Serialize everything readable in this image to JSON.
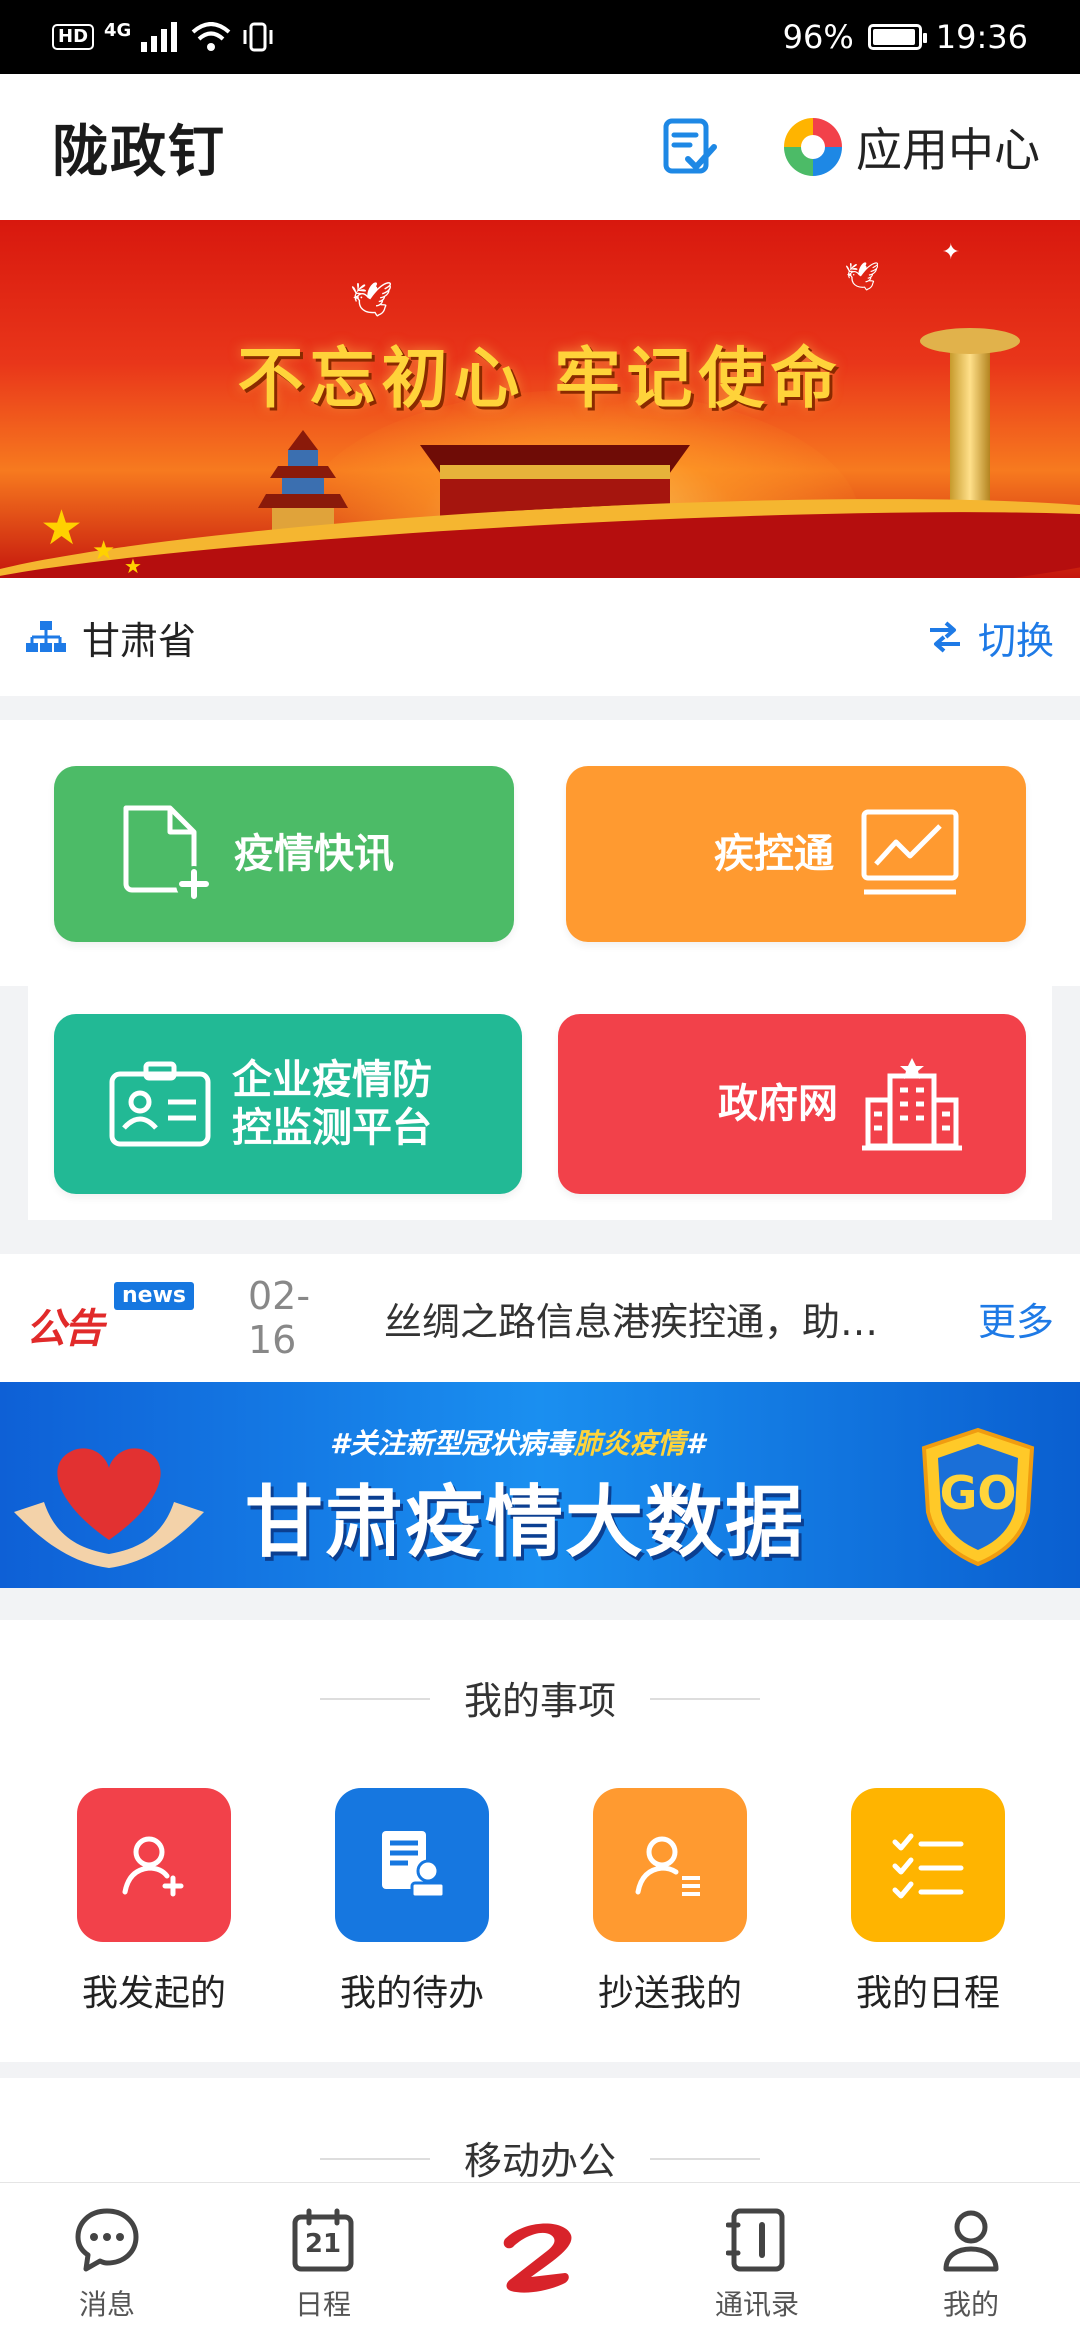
{
  "status_bar": {
    "hd": "HD",
    "network": "4G",
    "battery": "96%",
    "battery_level": 0.96,
    "time": "19:36"
  },
  "header": {
    "title": "陇政钉",
    "todo_icon": "clipboard-check-icon",
    "app_center_label": "应用中心"
  },
  "banner": {
    "slogan": "不忘初心 牢记使命"
  },
  "region": {
    "name": "甘肃省",
    "switch_label": "切换"
  },
  "quick_tiles": [
    {
      "label": "疫情快讯",
      "icon": "new-document-icon",
      "color": "#4cbb67"
    },
    {
      "label": "疾控通",
      "icon": "line-chart-icon",
      "color": "#ff9a30"
    },
    {
      "label_line1": "企业疫情防",
      "label_line2": "控监测平台",
      "icon": "id-card-icon",
      "color": "#22b995"
    },
    {
      "label": "政府网",
      "icon": "government-building-icon",
      "color": "#f2414a"
    }
  ],
  "notice": {
    "tag": "公告",
    "tag_badge": "news",
    "date": "02-16",
    "text": "丝绸之路信息港疾控通，助力疫情防控",
    "more_label": "更多"
  },
  "bigdata_banner": {
    "subtitle_prefix": "#关注新型冠状病毒",
    "subtitle_highlight": "肺炎疫情",
    "subtitle_suffix": "#",
    "title": "甘肃疫情大数据",
    "badge": "GO"
  },
  "my_items": {
    "title": "我的事项",
    "items": [
      {
        "label": "我发起的",
        "icon": "user-add-icon",
        "color": "#f2414a"
      },
      {
        "label": "我的待办",
        "icon": "document-stamp-icon",
        "color": "#1677e0"
      },
      {
        "label": "抄送我的",
        "icon": "user-list-icon",
        "color": "#ff9a30"
      },
      {
        "label": "我的日程",
        "icon": "checklist-icon",
        "color": "#ffb400"
      }
    ]
  },
  "mobile_office": {
    "title": "移动办公"
  },
  "bottom_nav": [
    {
      "label": "消息",
      "icon": "chat-bubble-icon"
    },
    {
      "label": "日程",
      "icon": "calendar-icon",
      "day": "21"
    },
    {
      "label": "",
      "icon": "app-logo-icon"
    },
    {
      "label": "通讯录",
      "icon": "contacts-book-icon"
    },
    {
      "label": "我的",
      "icon": "profile-icon"
    }
  ]
}
